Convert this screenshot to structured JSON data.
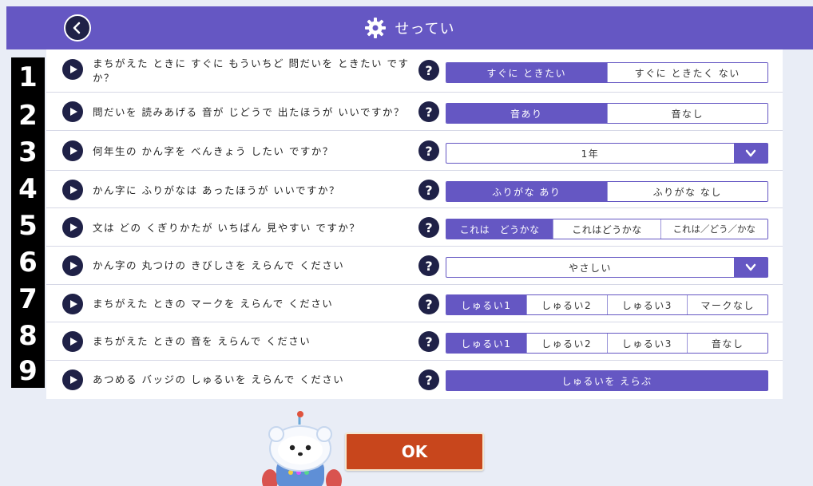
{
  "header": {
    "title": "せってい",
    "back_icon": "chevron-left-icon",
    "settings_icon": "gear-icon"
  },
  "row_numbers": [
    "1",
    "2",
    "3",
    "4",
    "5",
    "6",
    "7",
    "8",
    "9"
  ],
  "rows": [
    {
      "question": "まちがえた ときに すぐに もういちど 問だいを ときたい ですか？",
      "options": [
        "すぐに ときたい",
        "すぐに ときたく ない"
      ],
      "active": 0
    },
    {
      "question": "問だいを 読みあげる 音が じどうで 出たほうが いいですか？",
      "options": [
        "音あり",
        "音なし"
      ],
      "active": 0
    },
    {
      "question": "何年生の かん字を べんきょう したい ですか？",
      "select_value": "1年"
    },
    {
      "question": "かん字に ふりがなは あったほうが いいですか？",
      "options": [
        "ふりがな あり",
        "ふりがな なし"
      ],
      "active": 0
    },
    {
      "question": "文は どの くぎりかたが いちばん 見やすい ですか？",
      "options": [
        "これは　どうかな",
        "これはどうかな",
        "これは／どう／かな"
      ],
      "active": 0
    },
    {
      "question": "かん字の 丸つけの きびしさを えらんで ください",
      "select_value": "やさしい"
    },
    {
      "question": "まちがえた ときの マークを えらんで ください",
      "options": [
        "しゅるい1",
        "しゅるい2",
        "しゅるい3",
        "マークなし"
      ],
      "active": 0
    },
    {
      "question": "まちがえた ときの 音を えらんで ください",
      "options": [
        "しゅるい1",
        "しゅるい2",
        "しゅるい3",
        "音なし"
      ],
      "active": 0
    },
    {
      "question": "あつめる バッジの しゅるいを えらんで ください",
      "button": "しゅるいを えらぶ"
    }
  ],
  "help_label": "?",
  "footer": {
    "ok_label": "OK"
  },
  "colors": {
    "accent": "#6557c3",
    "dark": "#1f2147",
    "ok": "#c8461c"
  }
}
